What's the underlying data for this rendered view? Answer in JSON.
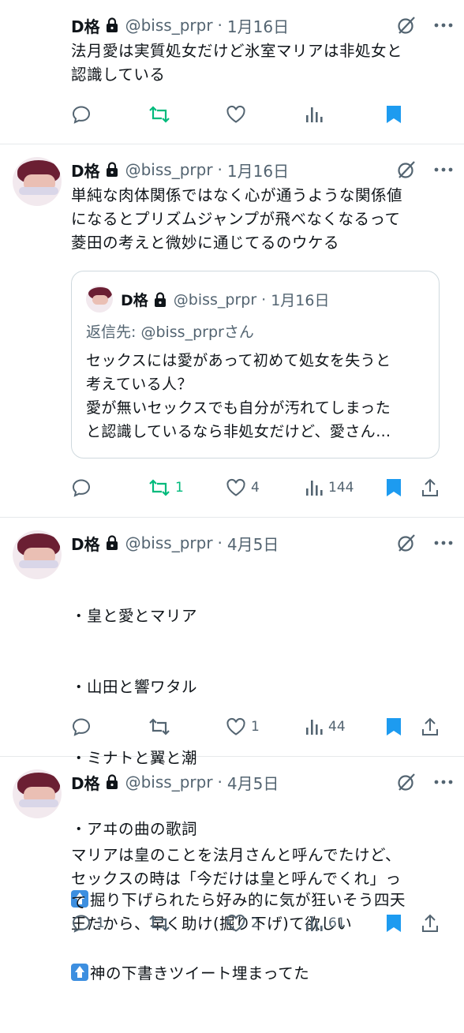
{
  "tweets": [
    {
      "name": "D格",
      "handle": "@biss_prpr",
      "sep": "·",
      "date": "1月16日",
      "text": "法月愛は実質処女だけど氷室マリアは非処女と\n認識している",
      "reply_count": "",
      "retweet_count": "",
      "like_count": "",
      "view_count": ""
    },
    {
      "name": "D格",
      "handle": "@biss_prpr",
      "sep": "·",
      "date": "1月16日",
      "text": "単純な肉体関係ではなく心が通うような関係値\nになるとプリズムジャンプが飛べなくなるって\n菱田の考えと微妙に通じてるのウケる",
      "quote": {
        "name": "D格",
        "handle": "@biss_prpr",
        "sep": "·",
        "date": "1月16日",
        "reply_to": "返信先: @biss_prprさん",
        "text": "セックスには愛があって初めて処女を失うと\n考えている人？\n愛が無いセックスでも自分が汚れてしまった\nと認識しているなら非処女だけど、愛さん…"
      },
      "reply_count": "",
      "retweet_count": "1",
      "like_count": "4",
      "view_count": "144"
    },
    {
      "name": "D格",
      "handle": "@biss_prpr",
      "sep": "·",
      "date": "4月5日",
      "lines": [
        "・皇と愛とマリア",
        "・山田と響ワタル",
        "・ミナトと翼と潮",
        "・アヰの曲の歌詞"
      ],
      "arrow_text": "掘り下げられたら好み的に気が狂いそう四天\n王だから、早く助け(掘り下げ)て欲しい",
      "reply_count": "",
      "retweet_count": "",
      "like_count": "1",
      "view_count": "44"
    },
    {
      "name": "D格",
      "handle": "@biss_prpr",
      "sep": "·",
      "date": "4月5日",
      "text": "マリアは皇のことを法月さんと呼んでたけど、\nセックスの時は「今だけは皇と呼んでくれ」っ\nて",
      "arrow_text": "神の下書きツイート埋まってた",
      "reply_count": "1",
      "retweet_count": "",
      "like_count": "2",
      "view_count": "61"
    }
  ],
  "colors": {
    "text": "#0f1419",
    "secondary": "#536471",
    "retweet_active": "#00ba7c",
    "bookmark_active": "#1d9bf0",
    "border": "#e6e9eb"
  },
  "icons": [
    "lock-icon",
    "grok-icon",
    "more-icon",
    "reply-icon",
    "retweet-icon",
    "like-icon",
    "views-icon",
    "bookmark-icon",
    "share-icon",
    "up-arrow-emoji"
  ]
}
